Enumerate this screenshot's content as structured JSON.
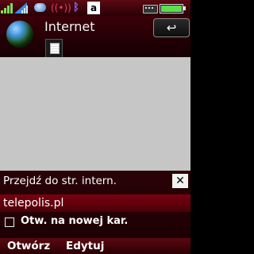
{
  "header": {
    "title": "Internet",
    "back_icon": "back-arrow-icon"
  },
  "dialog": {
    "title": "Przejdź do str. intern.",
    "close_glyph": "✕",
    "url_value": "telepolis.pl",
    "checkbox_label": "Otw. na nowej kar.",
    "checkbox_checked": false
  },
  "softkeys": {
    "left": "Otwórz",
    "middle": "Edytuj"
  },
  "status": {
    "indicator_letter": "a",
    "battery_level": 1.0
  },
  "colors": {
    "accent": "#7a0010",
    "content_bg": "#c6c6c6"
  }
}
